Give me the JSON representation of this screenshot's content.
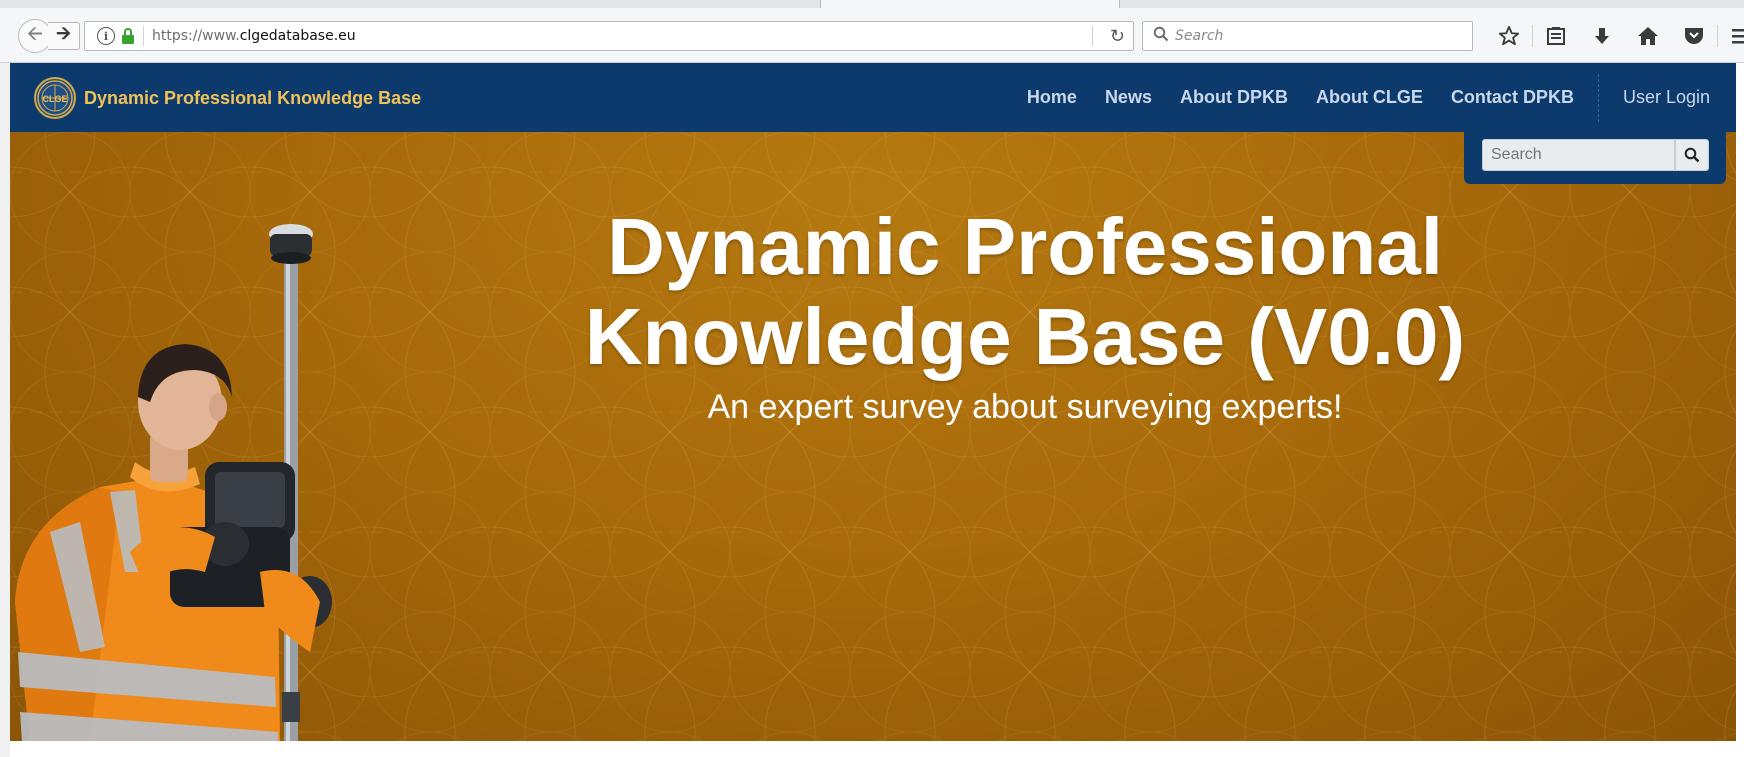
{
  "browser": {
    "url_prefix": "https://www.",
    "url_host": "clgedatabase.eu",
    "search_placeholder": "Search",
    "icons": [
      "star-icon",
      "reading-list-icon",
      "download-icon",
      "home-icon",
      "pocket-icon",
      "menu-icon"
    ]
  },
  "site": {
    "brand": "Dynamic Professional Knowledge Base",
    "logo_text": "CLGE",
    "nav": [
      "Home",
      "News",
      "About DPKB",
      "About CLGE",
      "Contact DPKB"
    ],
    "login": "User Login",
    "search_placeholder": "Search"
  },
  "hero": {
    "title_line1": "Dynamic Professional",
    "title_line2": "Knowledge Base (V0.0)",
    "subtitle": "An expert survey about surveying experts!"
  },
  "colors": {
    "nav_bg": "#0d3a6c",
    "brand_text": "#f1c15a",
    "hero_bg": "#a86a0a",
    "vest": "#f08a1a"
  }
}
